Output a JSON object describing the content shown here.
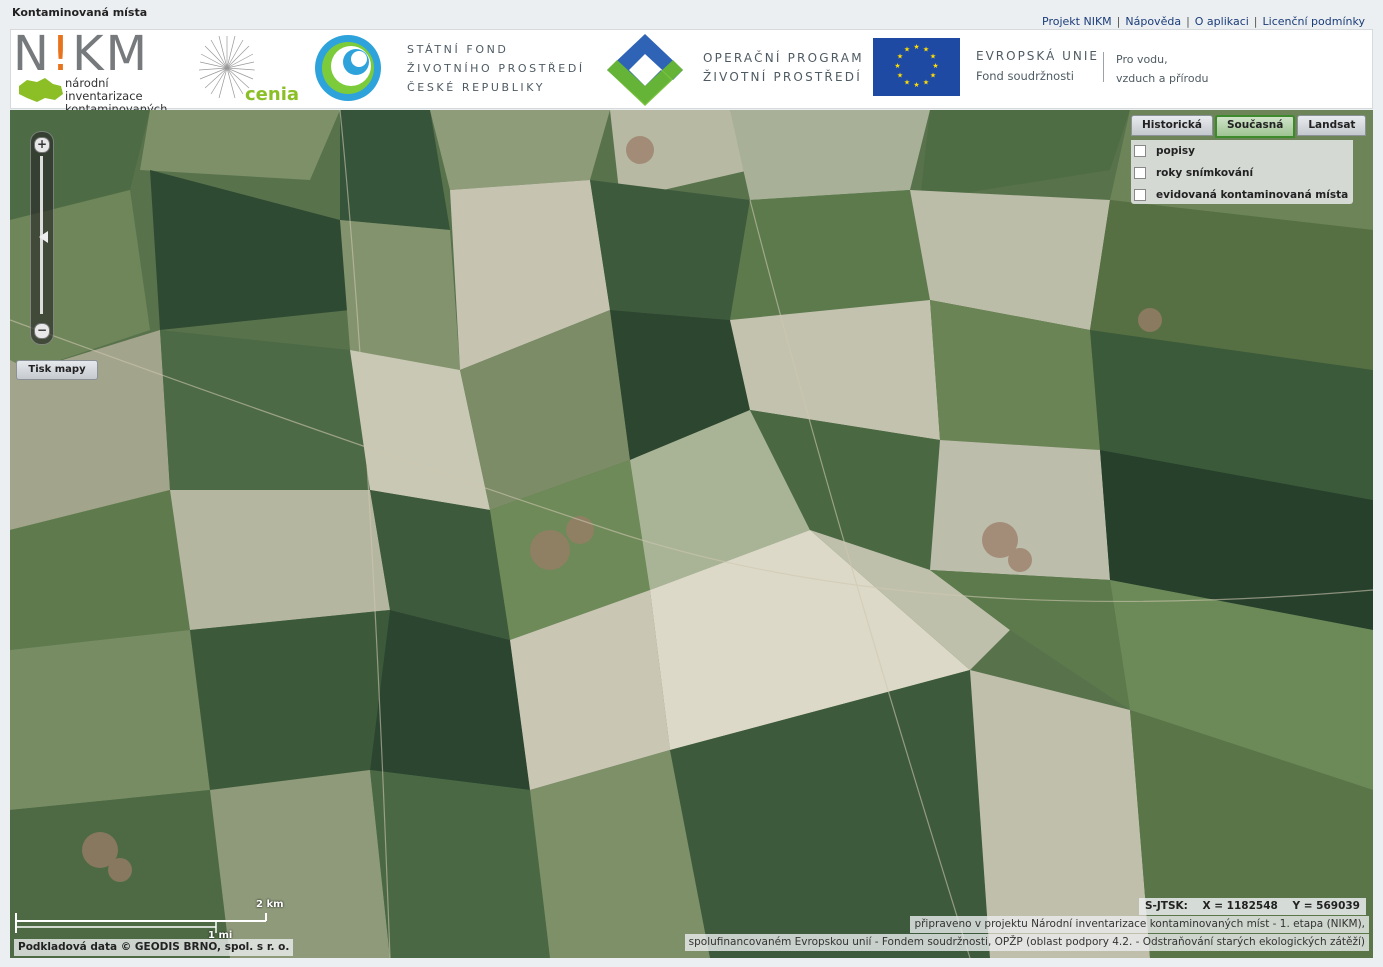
{
  "app": {
    "title": "Kontaminovaná místa"
  },
  "top_links": [
    "Projekt NIKM",
    "Nápověda",
    "O aplikaci",
    "Licenční podmínky"
  ],
  "banner": {
    "nikm_letters": [
      "N",
      "!",
      "KM"
    ],
    "nikm_subtitle_1": "národní inventarizace",
    "nikm_subtitle_2": "kontaminovaných míst",
    "cenia": "cenia",
    "sfzp_1": "STÁTNÍ FOND",
    "sfzp_2": "ŽIVOTNÍHO PROSTŘEDÍ",
    "sfzp_3": "ČESKÉ REPUBLIKY",
    "opzp_1": "OPERAČNÍ PROGRAM",
    "opzp_2": "ŽIVOTNÍ PROSTŘEDÍ",
    "eu_title": "EVROPSKÁ UNIE",
    "eu_fund": "Fond soudržnosti",
    "motto_1": "Pro vodu,",
    "motto_2": "vzduch a přírodu"
  },
  "map": {
    "zoom_in": "+",
    "zoom_out": "−",
    "print_label": "Tisk mapy",
    "layer_tabs": [
      {
        "label": "Historická",
        "active": false
      },
      {
        "label": "Současná",
        "active": true
      },
      {
        "label": "Landsat",
        "active": false
      }
    ],
    "overlays": [
      {
        "label": "popisy",
        "checked": false
      },
      {
        "label": "roky snímkování",
        "checked": false
      },
      {
        "label": "evidovaná kontaminovaná místa",
        "checked": false
      }
    ],
    "scale_km": "2 km",
    "scale_mi": "1 mi",
    "coords": "S-JTSK:    X = 1182548    Y = 569039",
    "credit": "Podkladová data © GEODIS BRNO, spol. s r. o.",
    "attribution_1": "připraveno v projektu Národní inventarizace kontaminovaných míst - 1. etapa (NIKM),",
    "attribution_2": "spolufinancovaném Evropskou unií - Fondem soudržnosti, OPŽP (oblast podpory 4.2. - Odstraňování starých ekologických zátěží)"
  },
  "colors": {
    "nikm_accent": "#e8731c",
    "cenia_green": "#8cbf26",
    "eu_blue": "#1f4aa3",
    "eu_star": "#ffdd00",
    "active_tab_border": "#3d8a2d"
  }
}
